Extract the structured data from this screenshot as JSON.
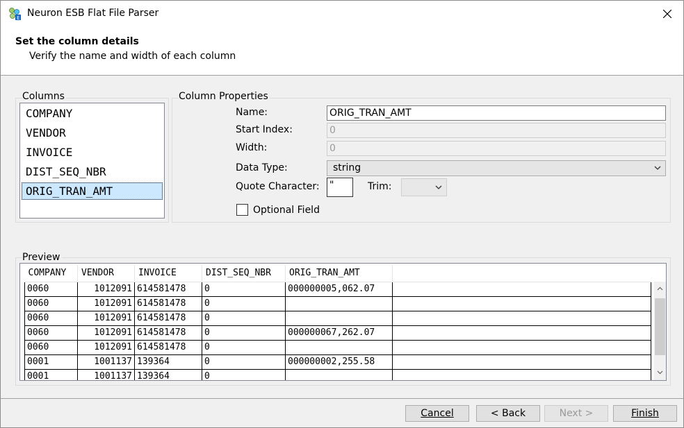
{
  "window": {
    "title": "Neuron ESB Flat File Parser",
    "close_icon": "close-icon"
  },
  "header": {
    "title": "Set the column details",
    "subtitle": "Verify the name and width of each column"
  },
  "columns": {
    "label": "Columns",
    "items": [
      "COMPANY",
      "VENDOR",
      "INVOICE",
      "DIST_SEQ_NBR",
      "ORIG_TRAN_AMT"
    ],
    "selected": "ORIG_TRAN_AMT"
  },
  "properties": {
    "label": "Column Properties",
    "name_label": "Name:",
    "name_value": "ORIG_TRAN_AMT",
    "start_index_label": "Start Index:",
    "start_index_value": "0",
    "width_label": "Width:",
    "width_value": "0",
    "data_type_label": "Data Type:",
    "data_type_value": "string",
    "quote_label": "Quote Character:",
    "quote_value": "\"",
    "trim_label": "Trim:",
    "trim_value": "",
    "optional_label": "Optional Field",
    "optional_checked": false
  },
  "preview": {
    "label": "Preview",
    "headers": [
      "COMPANY",
      "VENDOR",
      "INVOICE",
      "DIST_SEQ_NBR",
      "ORIG_TRAN_AMT"
    ],
    "rows": [
      [
        "0060",
        "1012091",
        "614581478",
        "0",
        "000000005,062.07"
      ],
      [
        "0060",
        "1012091",
        "614581478",
        "0",
        ""
      ],
      [
        "0060",
        "1012091",
        "614581478",
        "0",
        ""
      ],
      [
        "0060",
        "1012091",
        "614581478",
        "0",
        "000000067,262.07"
      ],
      [
        "0060",
        "1012091",
        "614581478",
        "0",
        ""
      ],
      [
        "0001",
        "1001137",
        "139364",
        "0",
        "000000002,255.58"
      ],
      [
        "0001",
        "1001137",
        "139364",
        "0",
        ""
      ]
    ]
  },
  "buttons": {
    "cancel": "Cancel",
    "back": "< Back",
    "next": "Next >",
    "finish": "Finish"
  },
  "colors": {
    "selection": "#cce8ff",
    "background": "#f0f0f0"
  }
}
